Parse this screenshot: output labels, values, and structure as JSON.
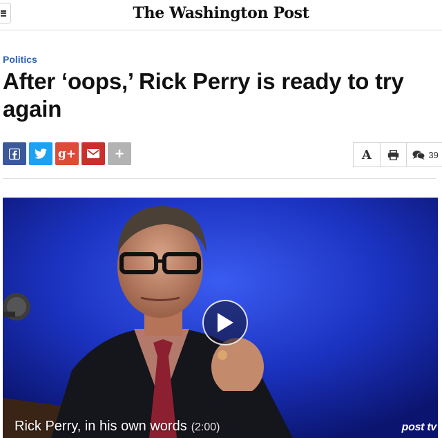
{
  "header": {
    "masthead": "The Washington Post",
    "menu_icon": "hamburger-icon"
  },
  "article": {
    "section": "Politics",
    "headline": "After ‘oops,’ Rick Perry is ready to try again"
  },
  "share": {
    "buttons": [
      {
        "name": "facebook",
        "icon": "facebook-icon",
        "color": "#3b5998"
      },
      {
        "name": "twitter",
        "icon": "twitter-icon",
        "color": "#1da1f2"
      },
      {
        "name": "google-plus",
        "label": "g+",
        "icon": "google-plus-icon",
        "color": "#dd4b39"
      },
      {
        "name": "email",
        "icon": "envelope-icon",
        "color": "#c9302c"
      },
      {
        "name": "more",
        "label": "+",
        "icon": "plus-icon",
        "color": "#b3b3b3"
      }
    ]
  },
  "tools": {
    "text_size_label": "A",
    "print_icon": "printer-icon",
    "comments_icon": "comments-icon",
    "comments_count": "39"
  },
  "video": {
    "caption": "Rick Perry, in his own words",
    "duration": "(2:00)",
    "brand": "post tv",
    "play_icon": "play-icon"
  },
  "colors": {
    "section_link": "#2a62b8",
    "video_background": "#1a2fb8"
  }
}
